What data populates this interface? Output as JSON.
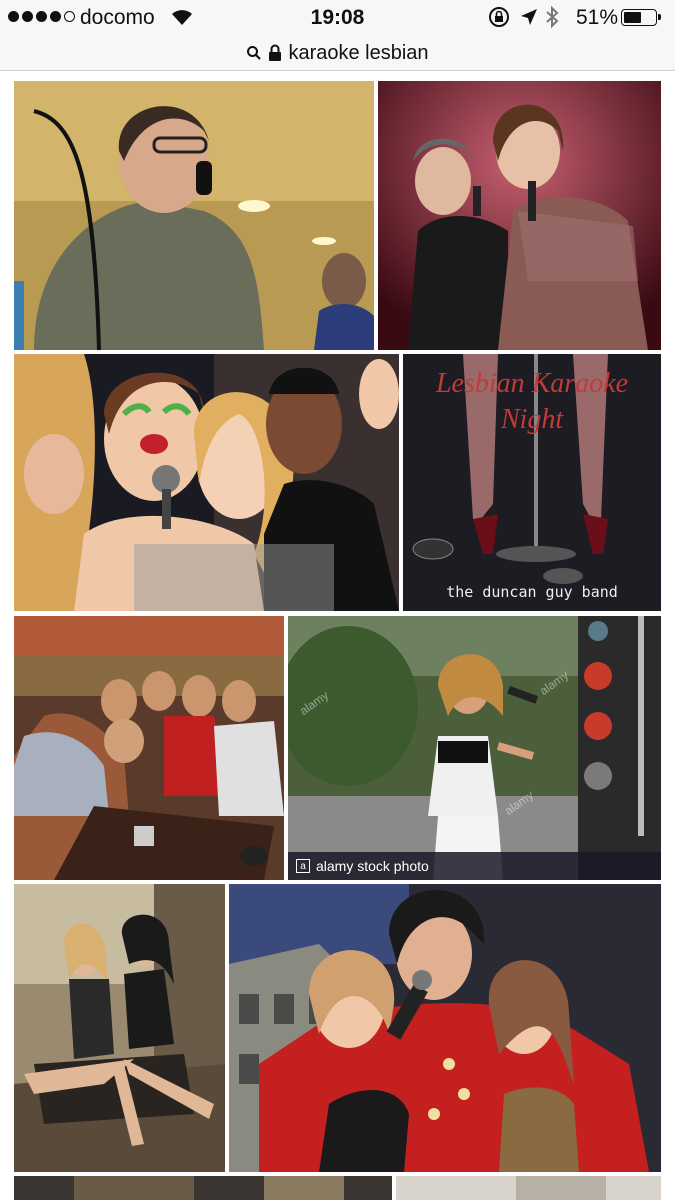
{
  "status": {
    "carrier": "docomo",
    "time": "19:08",
    "battery": "51%",
    "battery_level": 0.51,
    "icons": [
      "signal-dots",
      "wifi-icon",
      "rotation-lock-icon",
      "location-arrow-icon",
      "bluetooth-icon",
      "battery-icon"
    ]
  },
  "url_bar": {
    "query": "karaoke lesbian"
  },
  "images": [
    {
      "name": "karaoke-man-glasses"
    },
    {
      "name": "two-women-singing"
    },
    {
      "name": "group-laughing-microphone"
    },
    {
      "name": "lesbian-karaoke-night-cover",
      "title": "Lesbian Karaoke Night",
      "band": "the duncan guy band"
    },
    {
      "name": "men-group-bar"
    },
    {
      "name": "woman-stage-performance",
      "credit": "alamy stock photo",
      "logo": "a"
    },
    {
      "name": "two-women-posing"
    },
    {
      "name": "elvis-impersonator-women"
    }
  ]
}
